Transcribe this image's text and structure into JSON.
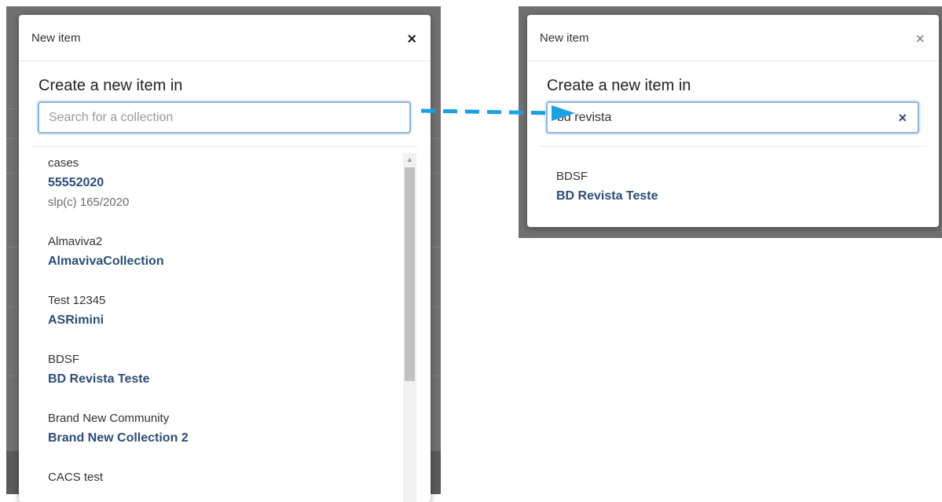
{
  "left_modal": {
    "title": "New item",
    "close_glyph": "×",
    "heading": "Create a new item in",
    "search": {
      "value": "",
      "placeholder": "Search for a collection"
    },
    "items": [
      {
        "parent": "cases",
        "name": "55552020",
        "extra": "slp(c) 165/2020"
      },
      {
        "parent": "Almaviva2",
        "name": "AlmavivaCollection"
      },
      {
        "parent": "Test 12345",
        "name": "ASRimini"
      },
      {
        "parent": "BDSF",
        "name": "BD Revista Teste"
      },
      {
        "parent": "Brand New Community",
        "name": "Brand New Collection 2"
      },
      {
        "parent": "CACS test",
        "name": ""
      }
    ]
  },
  "right_modal": {
    "title": "New item",
    "close_glyph": "×",
    "heading": "Create a new item in",
    "search": {
      "value": "bd revista",
      "placeholder": "Search for a collection",
      "clear_glyph": "×"
    },
    "items": [
      {
        "parent": "BDSF",
        "name": "BD Revista Teste"
      }
    ]
  },
  "colors": {
    "link": "#2c4d7a",
    "arrow": "#1ba1e2",
    "focus_border": "#8fb4d9"
  }
}
